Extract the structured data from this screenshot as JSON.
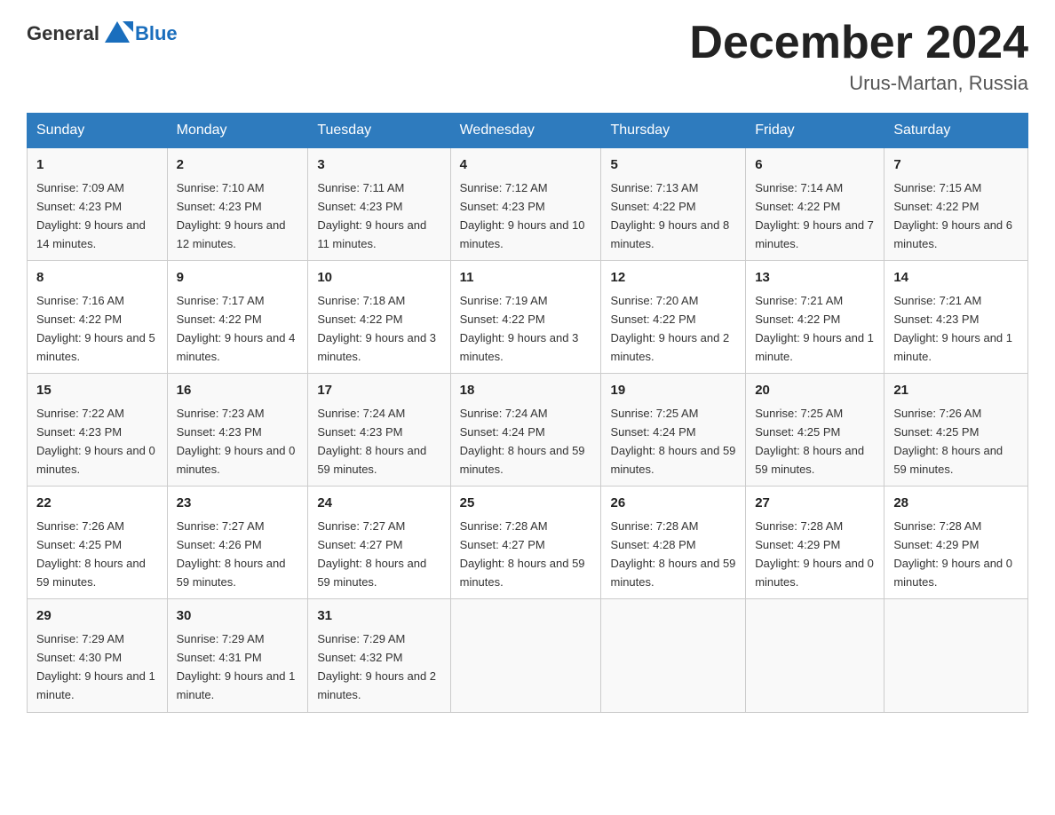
{
  "header": {
    "logo_general": "General",
    "logo_blue": "Blue",
    "month_title": "December 2024",
    "location": "Urus-Martan, Russia"
  },
  "days_of_week": [
    "Sunday",
    "Monday",
    "Tuesday",
    "Wednesday",
    "Thursday",
    "Friday",
    "Saturday"
  ],
  "weeks": [
    [
      {
        "day": "1",
        "sunrise": "7:09 AM",
        "sunset": "4:23 PM",
        "daylight": "9 hours and 14 minutes."
      },
      {
        "day": "2",
        "sunrise": "7:10 AM",
        "sunset": "4:23 PM",
        "daylight": "9 hours and 12 minutes."
      },
      {
        "day": "3",
        "sunrise": "7:11 AM",
        "sunset": "4:23 PM",
        "daylight": "9 hours and 11 minutes."
      },
      {
        "day": "4",
        "sunrise": "7:12 AM",
        "sunset": "4:23 PM",
        "daylight": "9 hours and 10 minutes."
      },
      {
        "day": "5",
        "sunrise": "7:13 AM",
        "sunset": "4:22 PM",
        "daylight": "9 hours and 8 minutes."
      },
      {
        "day": "6",
        "sunrise": "7:14 AM",
        "sunset": "4:22 PM",
        "daylight": "9 hours and 7 minutes."
      },
      {
        "day": "7",
        "sunrise": "7:15 AM",
        "sunset": "4:22 PM",
        "daylight": "9 hours and 6 minutes."
      }
    ],
    [
      {
        "day": "8",
        "sunrise": "7:16 AM",
        "sunset": "4:22 PM",
        "daylight": "9 hours and 5 minutes."
      },
      {
        "day": "9",
        "sunrise": "7:17 AM",
        "sunset": "4:22 PM",
        "daylight": "9 hours and 4 minutes."
      },
      {
        "day": "10",
        "sunrise": "7:18 AM",
        "sunset": "4:22 PM",
        "daylight": "9 hours and 3 minutes."
      },
      {
        "day": "11",
        "sunrise": "7:19 AM",
        "sunset": "4:22 PM",
        "daylight": "9 hours and 3 minutes."
      },
      {
        "day": "12",
        "sunrise": "7:20 AM",
        "sunset": "4:22 PM",
        "daylight": "9 hours and 2 minutes."
      },
      {
        "day": "13",
        "sunrise": "7:21 AM",
        "sunset": "4:22 PM",
        "daylight": "9 hours and 1 minute."
      },
      {
        "day": "14",
        "sunrise": "7:21 AM",
        "sunset": "4:23 PM",
        "daylight": "9 hours and 1 minute."
      }
    ],
    [
      {
        "day": "15",
        "sunrise": "7:22 AM",
        "sunset": "4:23 PM",
        "daylight": "9 hours and 0 minutes."
      },
      {
        "day": "16",
        "sunrise": "7:23 AM",
        "sunset": "4:23 PM",
        "daylight": "9 hours and 0 minutes."
      },
      {
        "day": "17",
        "sunrise": "7:24 AM",
        "sunset": "4:23 PM",
        "daylight": "8 hours and 59 minutes."
      },
      {
        "day": "18",
        "sunrise": "7:24 AM",
        "sunset": "4:24 PM",
        "daylight": "8 hours and 59 minutes."
      },
      {
        "day": "19",
        "sunrise": "7:25 AM",
        "sunset": "4:24 PM",
        "daylight": "8 hours and 59 minutes."
      },
      {
        "day": "20",
        "sunrise": "7:25 AM",
        "sunset": "4:25 PM",
        "daylight": "8 hours and 59 minutes."
      },
      {
        "day": "21",
        "sunrise": "7:26 AM",
        "sunset": "4:25 PM",
        "daylight": "8 hours and 59 minutes."
      }
    ],
    [
      {
        "day": "22",
        "sunrise": "7:26 AM",
        "sunset": "4:25 PM",
        "daylight": "8 hours and 59 minutes."
      },
      {
        "day": "23",
        "sunrise": "7:27 AM",
        "sunset": "4:26 PM",
        "daylight": "8 hours and 59 minutes."
      },
      {
        "day": "24",
        "sunrise": "7:27 AM",
        "sunset": "4:27 PM",
        "daylight": "8 hours and 59 minutes."
      },
      {
        "day": "25",
        "sunrise": "7:28 AM",
        "sunset": "4:27 PM",
        "daylight": "8 hours and 59 minutes."
      },
      {
        "day": "26",
        "sunrise": "7:28 AM",
        "sunset": "4:28 PM",
        "daylight": "8 hours and 59 minutes."
      },
      {
        "day": "27",
        "sunrise": "7:28 AM",
        "sunset": "4:29 PM",
        "daylight": "9 hours and 0 minutes."
      },
      {
        "day": "28",
        "sunrise": "7:28 AM",
        "sunset": "4:29 PM",
        "daylight": "9 hours and 0 minutes."
      }
    ],
    [
      {
        "day": "29",
        "sunrise": "7:29 AM",
        "sunset": "4:30 PM",
        "daylight": "9 hours and 1 minute."
      },
      {
        "day": "30",
        "sunrise": "7:29 AM",
        "sunset": "4:31 PM",
        "daylight": "9 hours and 1 minute."
      },
      {
        "day": "31",
        "sunrise": "7:29 AM",
        "sunset": "4:32 PM",
        "daylight": "9 hours and 2 minutes."
      },
      null,
      null,
      null,
      null
    ]
  ]
}
